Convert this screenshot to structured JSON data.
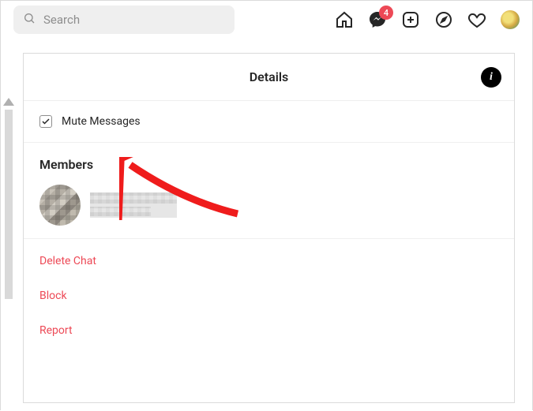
{
  "search": {
    "placeholder": "Search"
  },
  "notifications": {
    "messenger_count": "4"
  },
  "panel": {
    "title": "Details",
    "mute_label": "Mute Messages",
    "members_heading": "Members",
    "actions": {
      "delete": "Delete Chat",
      "block": "Block",
      "report": "Report"
    }
  },
  "info_glyph": "i"
}
